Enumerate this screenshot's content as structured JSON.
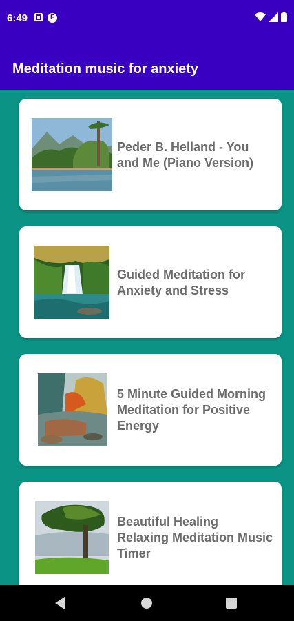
{
  "status": {
    "time": "6:49",
    "left_icons": [
      "notification-square-icon",
      "f-circle-icon"
    ],
    "right_icons": [
      "wifi-icon",
      "signal-icon",
      "battery-icon"
    ]
  },
  "app_bar": {
    "title": "Meditation music for anxiety"
  },
  "items": [
    {
      "title": "Peder B. Helland - You and Me (Piano Version)",
      "image": "mountain-lake-thumbnail"
    },
    {
      "title": "Guided Meditation for Anxiety and Stress",
      "image": "waterfall-thumbnail"
    },
    {
      "title": "5 Minute Guided Morning Meditation for Positive Energy",
      "image": "autumn-river-thumbnail"
    },
    {
      "title": "Beautiful Healing Relaxing Meditation Music Timer",
      "image": "tree-meadow-thumbnail"
    }
  ],
  "nav": {
    "buttons": [
      "back-icon",
      "home-icon",
      "recents-icon"
    ]
  },
  "colors": {
    "primary": "#3a00c2",
    "background": "#0b9485",
    "card_text": "#6b6b6b"
  }
}
